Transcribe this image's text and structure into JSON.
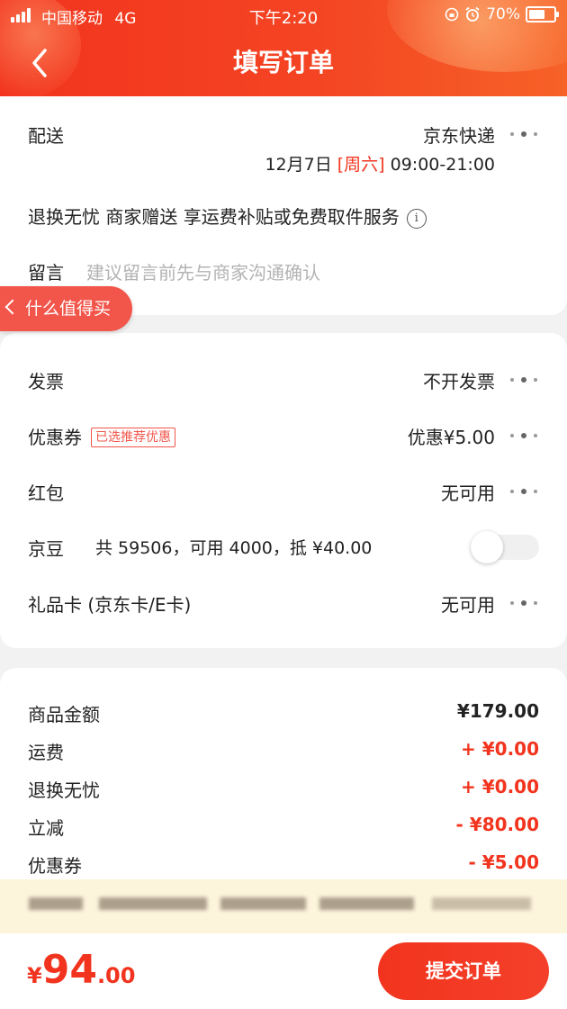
{
  "status_bar": {
    "carrier": "中国移动",
    "network": "4G",
    "time": "下午2:20",
    "battery": "70%",
    "battery_level": 0.7
  },
  "header": {
    "title": "填写订单"
  },
  "delivery": {
    "label": "配送",
    "courier": "京东快递",
    "date": "12月7日",
    "weekday": "[周六]",
    "window": "09:00-21:00",
    "return_text": "退换无忧 商家赠送 享运费补贴或免费取件服务",
    "message_label": "留言",
    "message_placeholder": "建议留言前先与商家沟通确认"
  },
  "side_pill": {
    "label": "什么值得买"
  },
  "options": {
    "invoice": {
      "label": "发票",
      "value": "不开发票"
    },
    "coupon": {
      "label": "优惠券",
      "badge": "已选推荐优惠",
      "value": "优惠¥5.00"
    },
    "redpacket": {
      "label": "红包",
      "value": "无可用"
    },
    "jingdou": {
      "label": "京豆",
      "detail": "共 59506，可用 4000，抵 ¥40.00",
      "enabled": false
    },
    "giftcard": {
      "label": "礼品卡 (京东卡/E卡)",
      "value": "无可用"
    }
  },
  "summary": [
    {
      "label": "商品金额",
      "value": "¥179.00",
      "color": "#222222"
    },
    {
      "label": "运费",
      "value": "+ ¥0.00",
      "color": "#f2341e"
    },
    {
      "label": "退换无忧",
      "value": "+ ¥0.00",
      "color": "#f2341e"
    },
    {
      "label": "立减",
      "value": "- ¥80.00",
      "color": "#f2341e"
    },
    {
      "label": "优惠券",
      "value": "- ¥5.00",
      "color": "#f2341e"
    }
  ],
  "footer": {
    "currency": "¥",
    "total_int": "94",
    "total_dec": ".00",
    "submit_label": "提交订单"
  },
  "colors": {
    "accent": "#f2341e",
    "background": "#f2f2f2"
  }
}
